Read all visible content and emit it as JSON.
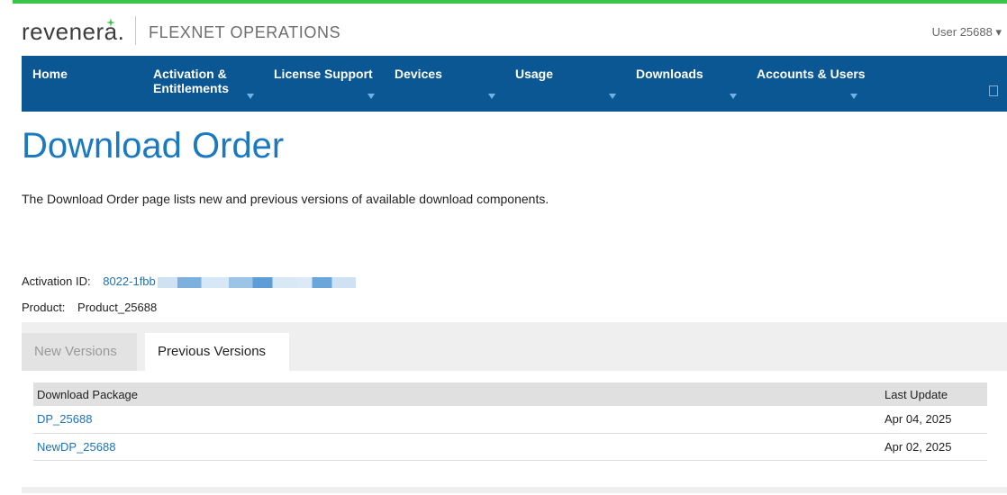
{
  "header": {
    "brand": "revenera.",
    "product": "FLEXNET OPERATIONS",
    "user": "User 25688 ▾"
  },
  "nav": {
    "items": [
      {
        "label": "Home",
        "caret": false
      },
      {
        "label": "Activation & Entitlements",
        "caret": true
      },
      {
        "label": "License Support",
        "caret": true
      },
      {
        "label": "Devices",
        "caret": true
      },
      {
        "label": "Usage",
        "caret": true
      },
      {
        "label": "Downloads",
        "caret": true
      },
      {
        "label": "Accounts & Users",
        "caret": true
      }
    ]
  },
  "page": {
    "title": "Download Order",
    "description": "The Download Order page lists new and previous versions of available download components."
  },
  "fields": {
    "activation_label": "Activation ID:",
    "activation_value": "8022-1fbb",
    "product_label": "Product:",
    "product_value": "Product_25688"
  },
  "tabs": {
    "new": "New Versions",
    "previous": "Previous Versions",
    "active": "previous"
  },
  "table": {
    "columns": [
      "Download Package",
      "Last Update"
    ],
    "rows": [
      {
        "package": "DP_25688",
        "date": "Apr 04, 2025"
      },
      {
        "package": "NewDP_25688",
        "date": "Apr 02, 2025"
      }
    ]
  },
  "colors": {
    "accent_green": "#39c44a",
    "nav_blue": "#0b5794",
    "title_blue": "#1b79c2",
    "link_blue": "#1d72b8"
  }
}
